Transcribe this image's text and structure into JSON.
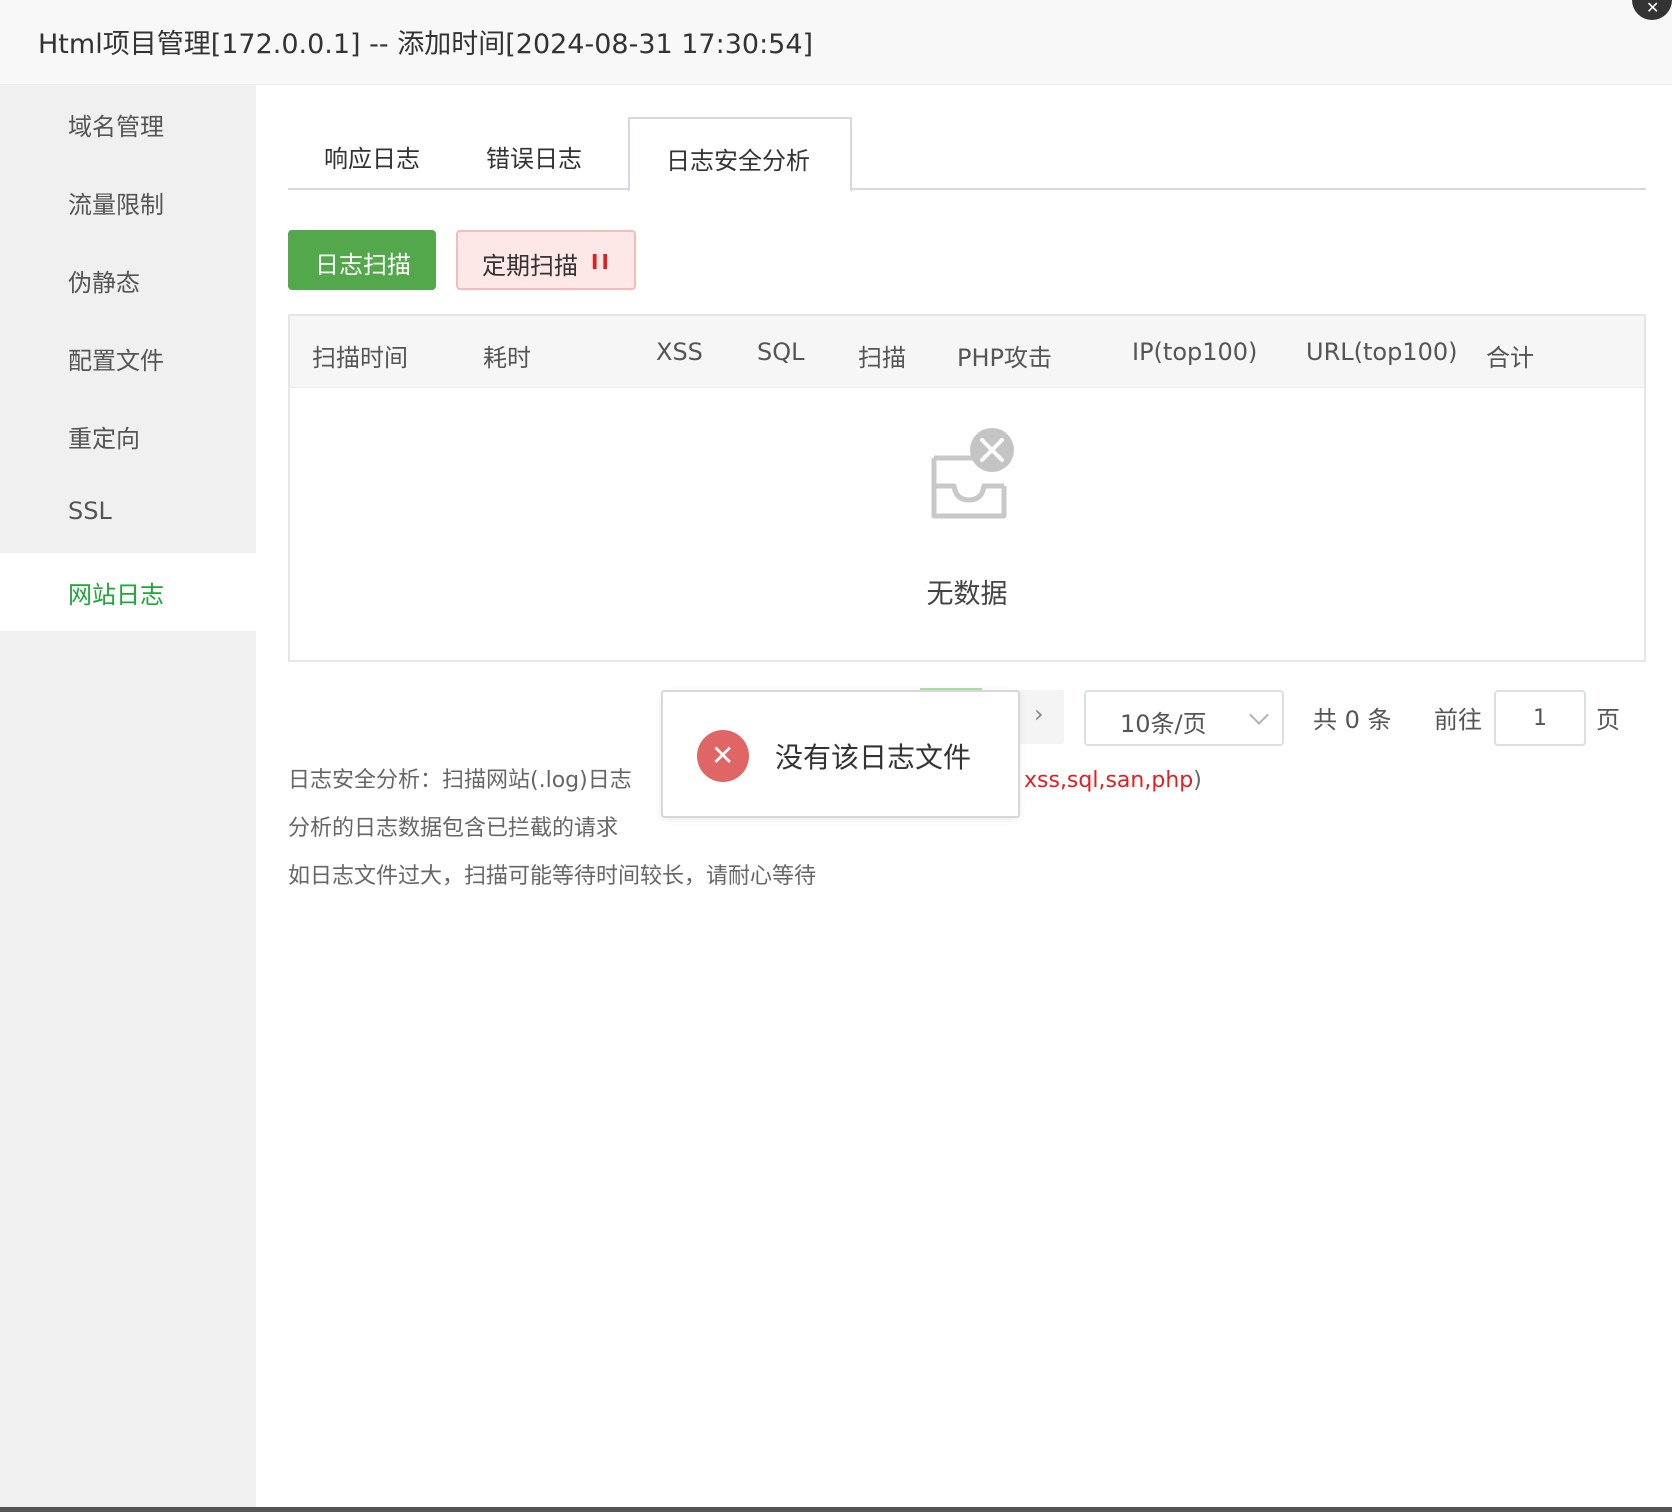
{
  "window": {
    "title": "Html项目管理[172.0.0.1] -- 添加时间[2024-08-31 17:30:54]",
    "close_glyph": "✕"
  },
  "sidebar": {
    "items": [
      {
        "label": "域名管理"
      },
      {
        "label": "流量限制"
      },
      {
        "label": "伪静态"
      },
      {
        "label": "配置文件"
      },
      {
        "label": "重定向"
      },
      {
        "label": "SSL"
      },
      {
        "label": "网站日志"
      }
    ],
    "active": "网站日志"
  },
  "tabs": [
    {
      "label": "响应日志"
    },
    {
      "label": "错误日志"
    },
    {
      "label": "日志安全分析"
    }
  ],
  "active_tab": "日志安全分析",
  "actions": {
    "scan_label": "日志扫描",
    "periodic_label": "定期扫描",
    "pause_glyph": "II"
  },
  "table": {
    "headers": [
      "扫描时间",
      "耗时",
      "XSS",
      "SQL",
      "扫描",
      "PHP攻击",
      "IP(top100)",
      "URL(top100)",
      "合计"
    ],
    "rows": [],
    "empty_text": "无数据"
  },
  "pagination": {
    "next_glyph": "›",
    "page_size": "10条/页",
    "total": "共 0 条",
    "goto_label": "前往",
    "page_value": "1",
    "page_suffix": "页"
  },
  "notes": {
    "line1_prefix": "日志安全分析：扫描网站(.log)日志",
    "line1_highlight": "xss,sql,san,php",
    "line1_suffix": ")",
    "line2": "分析的日志数据包含已拦截的请求",
    "line3": "如日志文件过大，扫描可能等待时间较长，请耐心等待"
  },
  "toast": {
    "message": "没有该日志文件",
    "icon_glyph": "✕"
  },
  "colors": {
    "accent_green": "#20a53a",
    "button_green": "#52a84a",
    "danger_red": "#e02020",
    "toast_icon": "#e06565"
  }
}
